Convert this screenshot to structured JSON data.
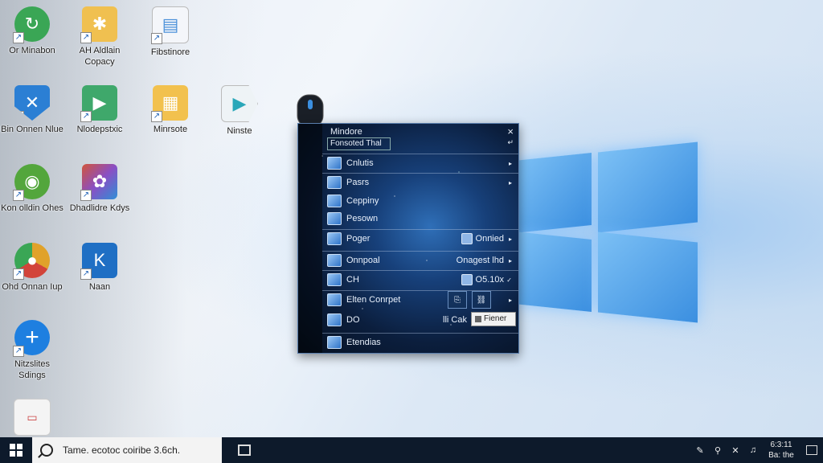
{
  "desktop": {
    "icons": [
      {
        "label": "Or Minabon",
        "icon": "green-app-icon",
        "color": "#3aa655"
      },
      {
        "label": "AH Aldlain Copacy",
        "icon": "folder-icon",
        "color": "#f0c050"
      },
      {
        "label": "Fibstinore",
        "icon": "document-icon",
        "color": "#4a90d9"
      },
      {
        "label": "Bin Onnen Nlue",
        "icon": "shield-app-icon",
        "color": "#2b7fd4"
      },
      {
        "label": "Nlodepstxic",
        "icon": "image-viewer-icon",
        "color": "#3fa86b"
      },
      {
        "label": "Minrsote",
        "icon": "folder-docs-icon",
        "color": "#f2c14e"
      },
      {
        "label": "Ninste",
        "icon": "media-player-icon",
        "color": "#2aa7b9"
      },
      {
        "label": "Kon olldin Ohes",
        "icon": "green-globe-icon",
        "color": "#53a63c"
      },
      {
        "label": "Dhadlidre Kdys",
        "icon": "office-app-icon",
        "color": "#d2553a"
      },
      {
        "label": "Ohd Onnan Iup",
        "icon": "chrome-app-icon",
        "color": "#e0a22a"
      },
      {
        "label": "Naan",
        "icon": "blue-doc-app-icon",
        "color": "#1f6fc4"
      },
      {
        "label": "Nitzslites Sdings",
        "icon": "plus-circle-icon",
        "color": "#1e7fe0"
      },
      {
        "label": "",
        "icon": "blank-document-icon",
        "color": "#dddddd"
      }
    ]
  },
  "menu": {
    "title": "Mindore",
    "close": "×",
    "subtitle": "Fonsoted Thal",
    "subtitle_icon": "↵",
    "items": [
      {
        "label": "Cnlutis",
        "right": "",
        "arrow": "▸"
      },
      {
        "label": "Pasrs",
        "right": "",
        "arrow": "▸"
      },
      {
        "label": "Ceppiny",
        "right": "",
        "arrow": ""
      },
      {
        "label": "Pesown",
        "right": "",
        "arrow": ""
      },
      {
        "label": "Poger",
        "right": "Onnied",
        "arrow": "▸"
      },
      {
        "label": "Onnpoal",
        "right": "Onagest lhd",
        "arrow": "▸"
      },
      {
        "label": "CH",
        "right": "O5.10x",
        "arrow": "✓"
      },
      {
        "label": "Elten Conrpet",
        "right": "",
        "arrow": "▸"
      },
      {
        "label": "DO",
        "right": "lli Cak",
        "arrow": ""
      },
      {
        "label": "Etendias",
        "right": "",
        "arrow": ""
      }
    ],
    "tooltip": "Fiener"
  },
  "taskbar": {
    "search_text": "Tame. ecotoc coiribe 3.6ch.",
    "clock_time": "6:3:11",
    "clock_date": "Ba: the",
    "tray_icons": [
      "pen-icon",
      "network-icon",
      "close-x-icon",
      "volume-icon"
    ]
  }
}
